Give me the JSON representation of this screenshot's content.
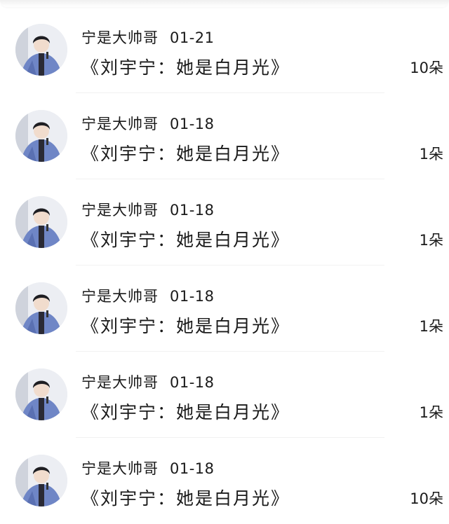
{
  "colors": {
    "background": "#ffffff",
    "text": "#1a1a1a",
    "divider": "#f1f1f1"
  },
  "items": [
    {
      "user": "宁是大帅哥",
      "date": "01-21",
      "title": "《刘宇宁：她是白月光》",
      "count": "10朵",
      "avatar_icon": "user-avatar-photo"
    },
    {
      "user": "宁是大帅哥",
      "date": "01-18",
      "title": "《刘宇宁：她是白月光》",
      "count": "1朵",
      "avatar_icon": "user-avatar-photo"
    },
    {
      "user": "宁是大帅哥",
      "date": "01-18",
      "title": "《刘宇宁：她是白月光》",
      "count": "1朵",
      "avatar_icon": "user-avatar-photo"
    },
    {
      "user": "宁是大帅哥",
      "date": "01-18",
      "title": "《刘宇宁：她是白月光》",
      "count": "1朵",
      "avatar_icon": "user-avatar-photo"
    },
    {
      "user": "宁是大帅哥",
      "date": "01-18",
      "title": "《刘宇宁：她是白月光》",
      "count": "1朵",
      "avatar_icon": "user-avatar-photo"
    },
    {
      "user": "宁是大帅哥",
      "date": "01-18",
      "title": "《刘宇宁：她是白月光》",
      "count": "10朵",
      "avatar_icon": "user-avatar-photo"
    }
  ]
}
